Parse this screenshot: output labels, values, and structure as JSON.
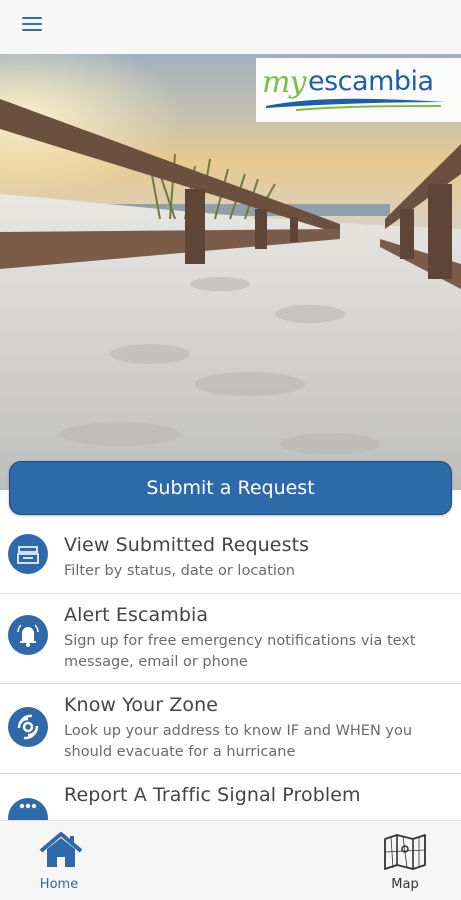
{
  "header": {
    "menu_icon": "hamburger-menu-icon"
  },
  "logo": {
    "part1": "my",
    "part2": "escambia"
  },
  "hero": {
    "image": "beach boardwalk with sand and wooden rails at sunset"
  },
  "primary_action": {
    "label": "Submit a Request"
  },
  "menu": {
    "items": [
      {
        "icon": "filing-tray-icon",
        "title": "View Submitted Requests",
        "subtitle": "Filter by status, date or location"
      },
      {
        "icon": "alert-bell-icon",
        "title": "Alert Escambia",
        "subtitle": "Sign up for free emergency notifications via text message, email or phone"
      },
      {
        "icon": "hurricane-icon",
        "title": "Know Your Zone",
        "subtitle": "Look up your address to know IF and WHEN you should evacuate for a hurricane"
      },
      {
        "icon": "traffic-signal-icon",
        "title": "Report A Traffic Signal Problem",
        "subtitle": ""
      }
    ]
  },
  "tabs": [
    {
      "label": "Home",
      "icon": "home-icon",
      "active": true
    },
    {
      "label": "Map",
      "icon": "map-icon",
      "active": false
    }
  ],
  "colors": {
    "brand_blue": "#2e69aa",
    "logo_green": "#7bbf3e"
  }
}
